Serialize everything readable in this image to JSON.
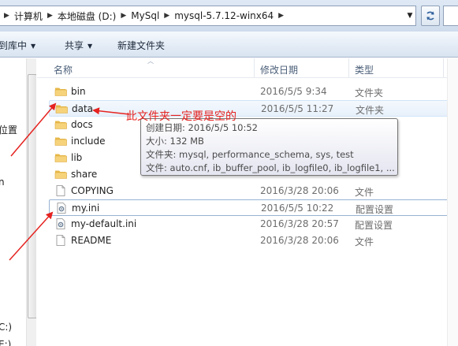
{
  "address": {
    "crumbs": [
      "计算机",
      "本地磁盘 (D:)",
      "MySql",
      "mysql-5.7.12-winx64"
    ]
  },
  "toolbar": {
    "include_in_library": "到库中",
    "share": "共享",
    "new_folder": "新建文件夹"
  },
  "nav": {
    "items": [
      "位置",
      "n",
      "C:)",
      "E:)"
    ]
  },
  "columns": {
    "name": "名称",
    "date": "修改日期",
    "type": "类型"
  },
  "files": [
    {
      "name": "bin",
      "date": "2016/5/5 9:34",
      "type": "文件夹",
      "icon": "folder-icon"
    },
    {
      "name": "data",
      "date": "2016/5/5 11:27",
      "type": "文件夹",
      "icon": "folder-icon"
    },
    {
      "name": "docs",
      "date": "",
      "type": "",
      "icon": "folder-icon"
    },
    {
      "name": "include",
      "date": "",
      "type": "",
      "icon": "folder-icon"
    },
    {
      "name": "lib",
      "date": "",
      "type": "",
      "icon": "folder-icon"
    },
    {
      "name": "share",
      "date": "",
      "type": "",
      "icon": "folder-icon"
    },
    {
      "name": "COPYING",
      "date": "2016/3/28 20:06",
      "type": "文件",
      "icon": "file-icon"
    },
    {
      "name": "my.ini",
      "date": "2016/5/5 10:22",
      "type": "配置设置",
      "icon": "config-file-icon"
    },
    {
      "name": "my-default.ini",
      "date": "2016/3/28 20:57",
      "type": "配置设置",
      "icon": "config-file-icon"
    },
    {
      "name": "README",
      "date": "2016/3/28 20:06",
      "type": "文件",
      "icon": "file-icon"
    }
  ],
  "tooltip": {
    "created": "创建日期: 2016/5/5 10:52",
    "size": "大小: 132 MB",
    "folders": "文件夹: mysql, performance_schema, sys, test",
    "files": "文件: auto.cnf, ib_buffer_pool, ib_logfile0, ib_logfile1, ..."
  },
  "annotation": {
    "text": "此文件夹一定要是空的",
    "color": "#e52320"
  }
}
